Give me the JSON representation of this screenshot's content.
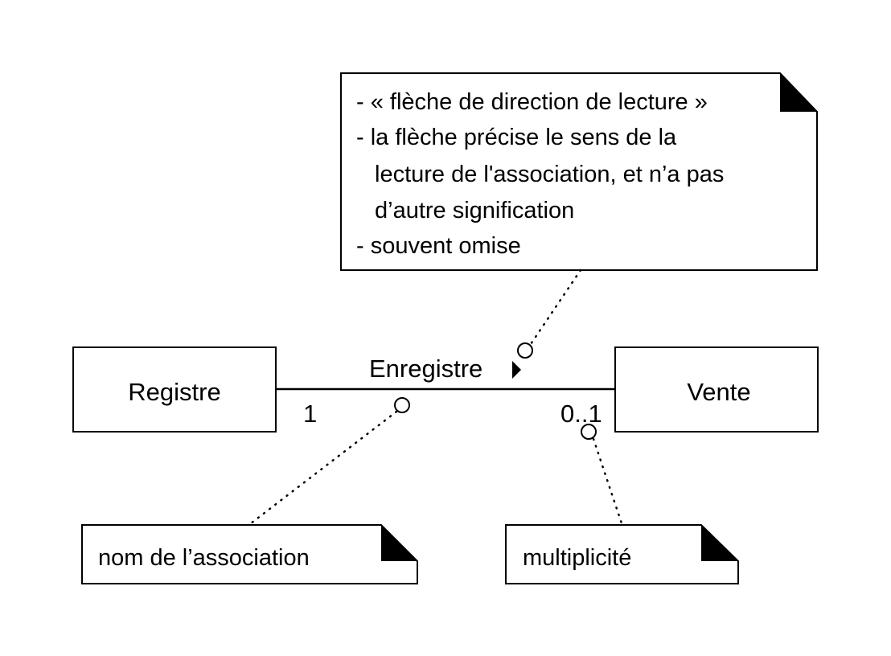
{
  "classes": {
    "left": {
      "name": "Registre"
    },
    "right": {
      "name": "Vente"
    }
  },
  "association": {
    "name": "Enregistre",
    "left_multiplicity": "1",
    "right_multiplicity": "0..1"
  },
  "notes": {
    "reading_direction": {
      "lines": [
        "- « flèche de direction de lecture »",
        "- la flèche précise le sens de la",
        "lecture de l'association, et n’a pas",
        "d’autre signification",
        "- souvent omise"
      ]
    },
    "association_name": {
      "text": "nom de l’association"
    },
    "multiplicity": {
      "text": "multiplicité"
    }
  },
  "colors": {
    "stroke": "#000000",
    "fill": "#ffffff"
  }
}
